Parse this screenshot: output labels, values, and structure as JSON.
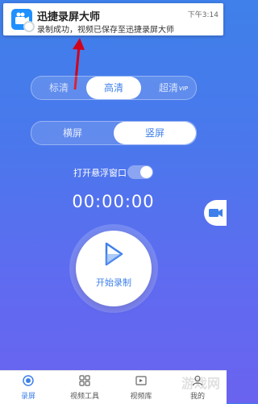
{
  "notification": {
    "app_name": "迅捷录屏大师",
    "time": "下午3:14",
    "message": "录制成功，视频已保存至迅捷录屏大师"
  },
  "quality": {
    "options": [
      "标清",
      "高清",
      "超清"
    ],
    "selected": "高清",
    "vip_badge": "VIP"
  },
  "orientation": {
    "options": [
      "横屏",
      "竖屏"
    ],
    "selected": "竖屏"
  },
  "floating_window": {
    "label": "打开悬浮窗口",
    "enabled": true
  },
  "timer": "00:00:00",
  "record": {
    "label": "开始录制"
  },
  "tabs": [
    {
      "label": "录屏",
      "icon": "record-icon",
      "active": true
    },
    {
      "label": "视频工具",
      "icon": "grid-icon",
      "active": false
    },
    {
      "label": "视频库",
      "icon": "library-icon",
      "active": false
    },
    {
      "label": "我的",
      "icon": "user-icon",
      "active": false
    }
  ],
  "colors": {
    "accent": "#3f80ea",
    "background_top": "#3f80ea",
    "background_bottom": "#6a63f0"
  },
  "watermark": "游戏网"
}
